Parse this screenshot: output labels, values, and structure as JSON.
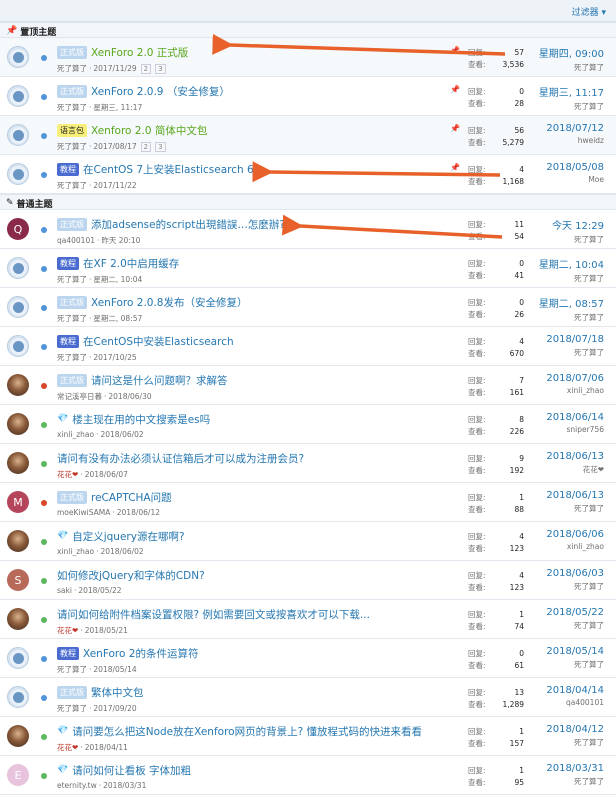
{
  "toolbar": {
    "filter_label": "过滤器 ▾"
  },
  "sections": {
    "pinned": "置顶主题",
    "normal": "普通主题"
  },
  "labels": {
    "replies": "回复:",
    "views": "查看:"
  },
  "pinned": [
    {
      "avatar": "xf",
      "avatar_letter": "",
      "dot": "blue",
      "prefix": "正式版",
      "prefix_class": "p-official",
      "title": "XenForo 2.0 正式版",
      "title_class": "green",
      "author": "死了算了",
      "date": "2017/11/29",
      "pages": [
        "2",
        "3"
      ],
      "replies": "57",
      "views": "3,536",
      "last_date": "星期四, 09:00",
      "last_user": "死了算了",
      "hl": true
    },
    {
      "avatar": "xf",
      "avatar_letter": "",
      "dot": "blue",
      "prefix": "正式版",
      "prefix_class": "p-official",
      "title": "XenForo 2.0.9 （安全修复）",
      "title_class": "",
      "author": "死了算了",
      "date": "星期三, 11:17",
      "pages": [],
      "replies": "0",
      "views": "28",
      "last_date": "星期三, 11:17",
      "last_user": "死了算了",
      "hl": false
    },
    {
      "avatar": "xf",
      "avatar_letter": "",
      "dot": "blue",
      "prefix": "语言包",
      "prefix_class": "p-lang",
      "title": "Xenforo 2.0 简体中文包",
      "title_class": "green",
      "author": "死了算了",
      "date": "2017/08/17",
      "pages": [
        "2",
        "3"
      ],
      "replies": "56",
      "views": "5,279",
      "last_date": "2018/07/12",
      "last_user": "hweidz",
      "hl": true
    },
    {
      "avatar": "xf",
      "avatar_letter": "",
      "dot": "blue",
      "prefix": "教程",
      "prefix_class": "p-tutorial",
      "title": "在CentOS 7上安装Elasticsearch 6",
      "title_class": "",
      "author": "死了算了",
      "date": "2017/11/22",
      "pages": [],
      "replies": "4",
      "views": "1,168",
      "last_date": "2018/05/08",
      "last_user": "Moe",
      "hl": false
    }
  ],
  "normal": [
    {
      "avatar": "letter",
      "avatar_letter": "Q",
      "avatar_color": "#8a2a4a",
      "dot": "blue",
      "prefix": "正式版",
      "prefix_class": "p-official",
      "title": "添加adsense的script出現錯誤…怎麼辦?",
      "title_class": "",
      "author": "qa400101",
      "date": "昨天 20:10",
      "replies": "11",
      "views": "54",
      "last_date": "今天 12:29",
      "last_user": "死了算了",
      "author_red": false
    },
    {
      "avatar": "xf",
      "avatar_letter": "",
      "dot": "blue",
      "prefix": "教程",
      "prefix_class": "p-tutorial",
      "title": "在XF 2.0中启用缓存",
      "title_class": "",
      "author": "死了算了",
      "date": "星期二, 10:04",
      "replies": "0",
      "views": "41",
      "last_date": "星期二, 10:04",
      "last_user": "死了算了",
      "author_red": false
    },
    {
      "avatar": "xf",
      "avatar_letter": "",
      "dot": "blue",
      "prefix": "正式版",
      "prefix_class": "p-official",
      "title": "XenForo 2.0.8发布（安全修复）",
      "title_class": "",
      "author": "死了算了",
      "date": "星期二, 08:57",
      "replies": "0",
      "views": "26",
      "last_date": "星期二, 08:57",
      "last_user": "死了算了",
      "author_red": false
    },
    {
      "avatar": "xf",
      "avatar_letter": "",
      "dot": "blue",
      "prefix": "教程",
      "prefix_class": "p-tutorial",
      "title": "在CentOS中安装Elasticsearch",
      "title_class": "",
      "author": "死了算了",
      "date": "2017/10/25",
      "replies": "4",
      "views": "670",
      "last_date": "2018/07/18",
      "last_user": "死了算了",
      "author_red": false
    },
    {
      "avatar": "photo",
      "avatar_letter": "",
      "dot": "red",
      "prefix": "正式版",
      "prefix_class": "p-official",
      "title": "请问这是什么问题啊？求解答",
      "title_class": "",
      "author": "常记溪亭日暮",
      "date": "2018/06/30",
      "replies": "7",
      "views": "161",
      "last_date": "2018/07/06",
      "last_user": "xinli_zhao",
      "author_red": false
    },
    {
      "avatar": "photo",
      "avatar_letter": "",
      "dot": "green",
      "prefix": "",
      "prefix_class": "",
      "gem": "💎",
      "title": "楼主现在用的中文搜索是es吗",
      "title_class": "",
      "author": "xinli_zhao",
      "date": "2018/06/02",
      "replies": "8",
      "views": "226",
      "last_date": "2018/06/14",
      "last_user": "sniper756",
      "author_red": false
    },
    {
      "avatar": "photo",
      "avatar_letter": "",
      "dot": "green",
      "prefix": "",
      "prefix_class": "",
      "title": "请问有没有办法必须认证信箱后才可以成为注册会员?",
      "title_class": "",
      "author": "花花❤",
      "date": "2018/06/07",
      "replies": "9",
      "views": "192",
      "last_date": "2018/06/13",
      "last_user": "花花❤",
      "author_red": true
    },
    {
      "avatar": "letter",
      "avatar_letter": "M",
      "avatar_color": "#b5455a",
      "dot": "red",
      "prefix": "正式版",
      "prefix_class": "p-official",
      "title": "reCAPTCHA问题",
      "title_class": "",
      "author": "moeKiwiSAMA",
      "date": "2018/06/12",
      "replies": "1",
      "views": "88",
      "last_date": "2018/06/13",
      "last_user": "死了算了",
      "author_red": false
    },
    {
      "avatar": "photo",
      "avatar_letter": "",
      "dot": "green",
      "prefix": "",
      "prefix_class": "",
      "gem": "💎",
      "title": "自定义jquery源在哪啊?",
      "title_class": "",
      "author": "xinli_zhao",
      "date": "2018/06/02",
      "replies": "4",
      "views": "123",
      "last_date": "2018/06/06",
      "last_user": "xinli_zhao",
      "author_red": false
    },
    {
      "avatar": "letter",
      "avatar_letter": "S",
      "avatar_color": "#b86a5a",
      "dot": "green",
      "prefix": "",
      "prefix_class": "",
      "title": "如何修改jQuery和字体的CDN?",
      "title_class": "",
      "author": "saki",
      "date": "2018/05/22",
      "replies": "4",
      "views": "123",
      "last_date": "2018/06/03",
      "last_user": "死了算了",
      "author_red": false
    },
    {
      "avatar": "photo",
      "avatar_letter": "",
      "dot": "green",
      "prefix": "",
      "prefix_class": "",
      "title": "请问如何给附件档案设置权限? 例如需要回文或按喜欢才可以下载...",
      "title_class": "",
      "author": "花花❤",
      "date": "2018/05/21",
      "replies": "1",
      "views": "74",
      "last_date": "2018/05/22",
      "last_user": "死了算了",
      "author_red": true
    },
    {
      "avatar": "xf",
      "avatar_letter": "",
      "dot": "blue",
      "prefix": "教程",
      "prefix_class": "p-tutorial",
      "title": "XenForo 2的条件运算符",
      "title_class": "",
      "author": "死了算了",
      "date": "2018/05/14",
      "replies": "0",
      "views": "61",
      "last_date": "2018/05/14",
      "last_user": "死了算了",
      "author_red": false
    },
    {
      "avatar": "xf",
      "avatar_letter": "",
      "dot": "blue",
      "prefix": "正式版",
      "prefix_class": "p-official",
      "title": "繁体中文包",
      "title_class": "",
      "author": "死了算了",
      "date": "2017/09/20",
      "replies": "13",
      "views": "1,289",
      "last_date": "2018/04/14",
      "last_user": "qa400101",
      "author_red": false
    },
    {
      "avatar": "photo",
      "avatar_letter": "",
      "dot": "green",
      "prefix": "",
      "prefix_class": "",
      "gem": "💎",
      "title": "请问要怎么把这Node放在Xenforo网页的背景上? 懂放程式码的快进来看看",
      "title_class": "",
      "author": "花花❤",
      "date": "2018/04/11",
      "replies": "1",
      "views": "157",
      "last_date": "2018/04/12",
      "last_user": "死了算了",
      "author_red": true
    },
    {
      "avatar": "letter",
      "avatar_letter": "E",
      "avatar_color": "#e8c3dd",
      "dot": "green",
      "prefix": "",
      "prefix_class": "",
      "gem": "💎",
      "title": "请问如何让看板 字体加粗",
      "title_class": "",
      "author": "eternity.tw",
      "date": "2018/03/31",
      "replies": "1",
      "views": "95",
      "last_date": "2018/03/31",
      "last_user": "死了算了",
      "author_red": false
    }
  ]
}
